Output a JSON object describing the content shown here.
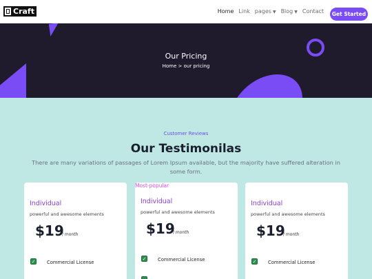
{
  "brand": {
    "name": "Craft"
  },
  "nav": {
    "items": [
      {
        "label": "Home",
        "active": true,
        "dropdown": false
      },
      {
        "label": "Link",
        "active": false,
        "dropdown": false
      },
      {
        "label": "pages",
        "active": false,
        "dropdown": true
      },
      {
        "label": "Blog",
        "active": false,
        "dropdown": true
      },
      {
        "label": "Contact",
        "active": false,
        "dropdown": false
      }
    ],
    "cta_label": "Get Started"
  },
  "hero": {
    "title": "Our Pricing",
    "breadcrumb": "Home > our pricing"
  },
  "section": {
    "eyebrow": "Customer Reviews",
    "title": "Our Testimonilas",
    "description": "There are many variations of passages of Lorem Ipsum available, but the majority have suffered alteration in some form."
  },
  "cards": [
    {
      "plan": "Individual",
      "desc": "powerful and awesome elements",
      "price": "$19",
      "period": "/ month",
      "features": [
        "Commercial License"
      ]
    },
    {
      "badge": "Most-popular",
      "plan": "Individual",
      "desc": "powerful and awesome elements",
      "price": "$19",
      "period": "/ month",
      "features": [
        "Commercial License"
      ]
    },
    {
      "plan": "Individual",
      "desc": "powerful and awesome elements",
      "price": "$19",
      "period": "/ month",
      "features": [
        "Commercial License"
      ]
    }
  ],
  "colors": {
    "accent": "#7a4cf5",
    "hero_bg": "#1f1b2d",
    "section_bg": "#bfe7e4",
    "plan_name": "#8a3fd9",
    "badge": "#d24fd8",
    "check": "#2f8f4f"
  },
  "icons": {
    "logo": "craft-logo-icon",
    "dropdown": "chevron-down-icon",
    "feature": "checkbox-checked-icon"
  }
}
